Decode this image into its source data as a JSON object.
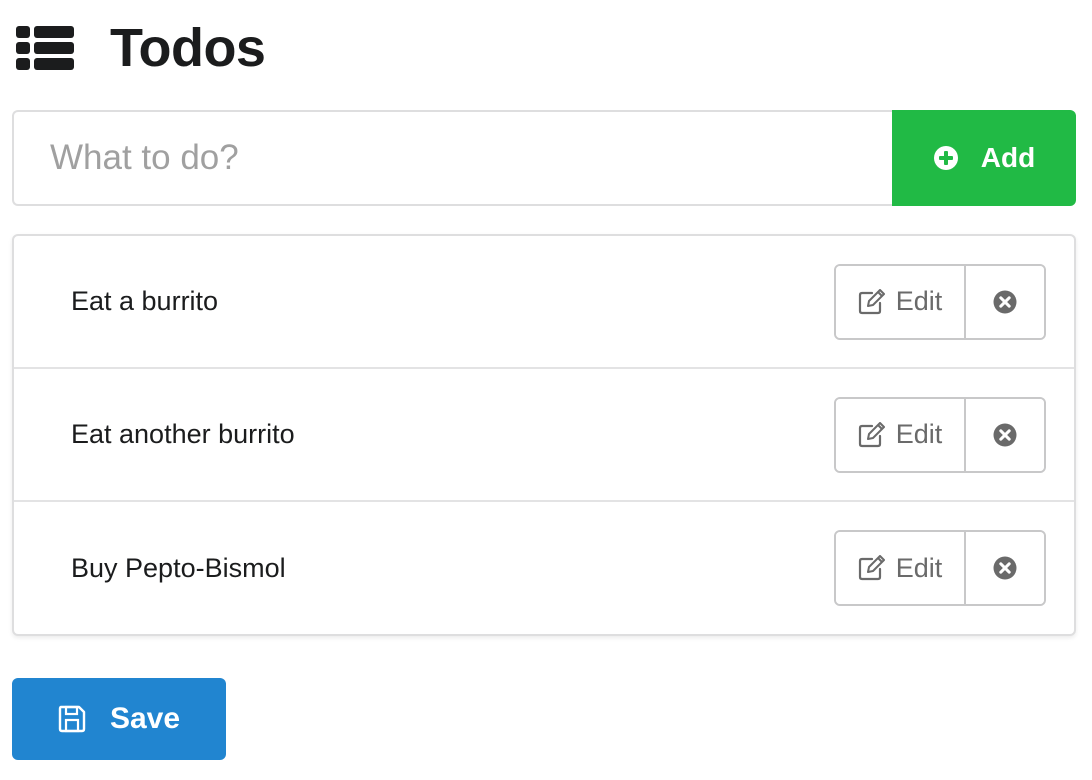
{
  "header": {
    "title": "Todos",
    "icon": "list-icon"
  },
  "input": {
    "value": "",
    "placeholder": "What to do?"
  },
  "add_button": {
    "label": "Add",
    "icon": "plus-circle-icon",
    "color": "#21ba45"
  },
  "todos": [
    {
      "text": "Eat a burrito",
      "edit_label": "Edit"
    },
    {
      "text": "Eat another burrito",
      "edit_label": "Edit"
    },
    {
      "text": "Buy Pepto-Bismol",
      "edit_label": "Edit"
    }
  ],
  "save_button": {
    "label": "Save",
    "icon": "floppy-disk-icon",
    "color": "#2185d0"
  }
}
